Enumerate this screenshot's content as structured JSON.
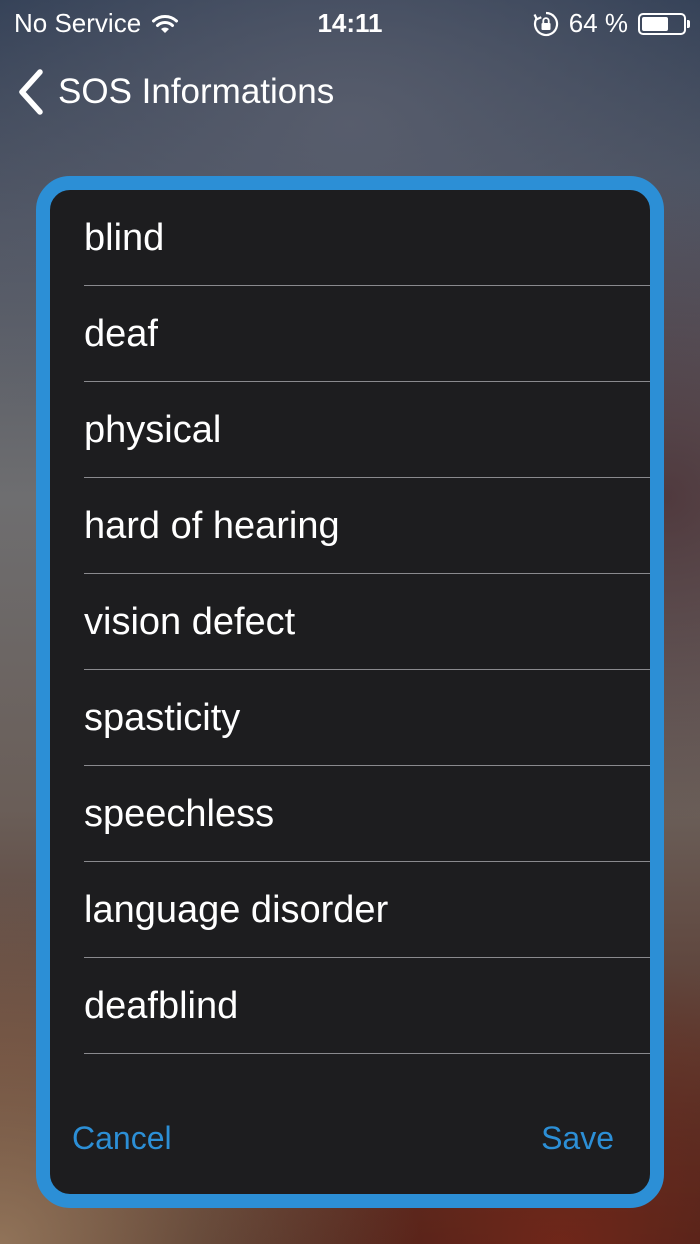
{
  "status_bar": {
    "carrier": "No Service",
    "time": "14:11",
    "battery_percent_label": "64 %",
    "battery_level": 0.64,
    "icons": [
      "wifi-icon",
      "rotation-lock-icon",
      "battery-icon"
    ]
  },
  "nav": {
    "back_label": "SOS Informations",
    "back_icon": "chevron-left-icon"
  },
  "dialog": {
    "accent_color": "#2c8fd6",
    "background_color": "#1d1d1f",
    "options": [
      {
        "label": "blind"
      },
      {
        "label": "deaf"
      },
      {
        "label": "physical"
      },
      {
        "label": "hard of hearing"
      },
      {
        "label": "vision defect"
      },
      {
        "label": "spasticity"
      },
      {
        "label": "speechless"
      },
      {
        "label": "language disorder"
      },
      {
        "label": "deafblind"
      }
    ],
    "cancel_label": "Cancel",
    "save_label": "Save"
  }
}
